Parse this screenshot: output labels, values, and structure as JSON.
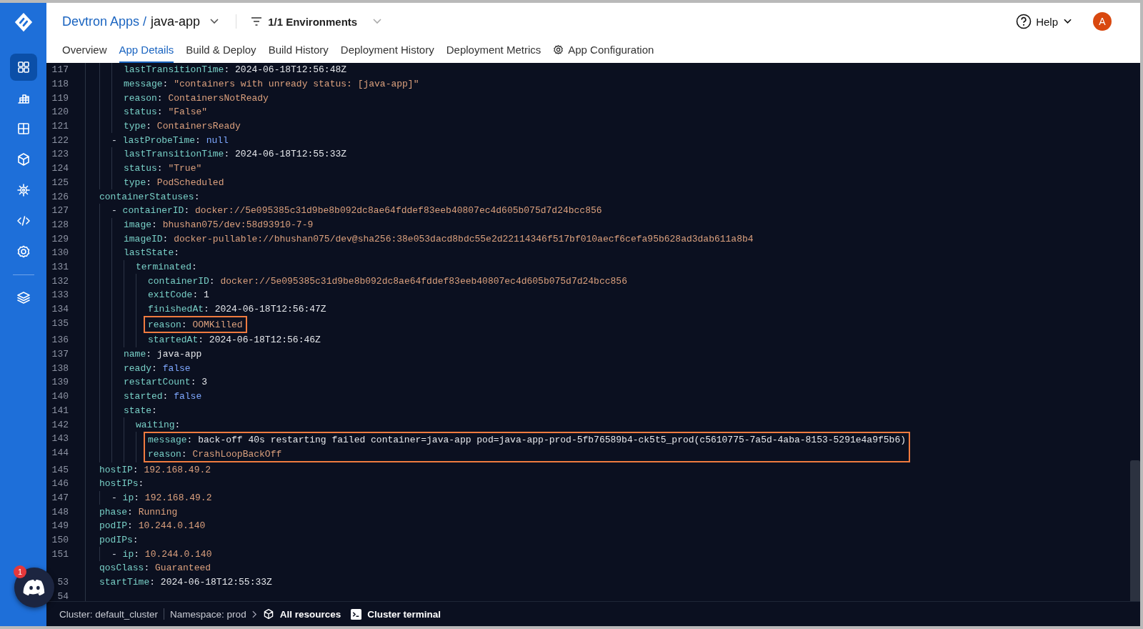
{
  "sidebar": {
    "items": [
      {
        "selected": true
      },
      {
        "selected": false
      },
      {
        "selected": false
      },
      {
        "selected": false
      },
      {
        "selected": false
      },
      {
        "selected": false
      },
      {
        "selected": false
      },
      {
        "selected": false
      }
    ]
  },
  "header": {
    "breadcrumb_parent": "Devtron Apps /",
    "app_name": "java-app",
    "environments": "1/1 Environments",
    "help": "Help",
    "avatar": "A"
  },
  "tabs": [
    {
      "label": "Overview",
      "selected": false
    },
    {
      "label": "App Details",
      "selected": true
    },
    {
      "label": "Build & Deploy",
      "selected": false
    },
    {
      "label": "Build History",
      "selected": false
    },
    {
      "label": "Deployment History",
      "selected": false
    },
    {
      "label": "Deployment Metrics",
      "selected": false
    },
    {
      "label": "App Configuration",
      "selected": false
    }
  ],
  "code": {
    "lines": [
      {
        "children": [
          {
            "children": [
              {
                "number": "117",
                "key": "lastTransitionTime:",
                "value": "2024-06-18T12:56:48Z",
                "kind": "plain"
              },
              {
                "number": "118",
                "key": "message:",
                "value": "\"containers with unready status: [java-app]\"",
                "kind": "string"
              },
              {
                "number": "119",
                "key": "reason:",
                "value": "ContainersNotReady",
                "kind": "string"
              },
              {
                "number": "120",
                "key": "status:",
                "value": "\"False\"",
                "kind": "string"
              },
              {
                "number": "121",
                "key": "type:",
                "value": "ContainersReady",
                "kind": "string"
              }
            ]
          },
          {
            "children": [
              {
                "number": "122",
                "marker": "-",
                "key": "lastProbeTime:",
                "value": "null",
                "kind": "keyword"
              },
              {
                "number": "123",
                "key": "lastTransitionTime:",
                "value": "2024-06-18T12:55:33Z",
                "kind": "plain"
              },
              {
                "number": "124",
                "key": "status:",
                "value": "\"True\"",
                "kind": "string"
              },
              {
                "number": "125",
                "key": "type:",
                "value": "PodScheduled",
                "kind": "string"
              }
            ]
          }
        ]
      },
      {
        "number": "126",
        "key": "containerStatuses:",
        "children": [
          {
            "children": [
              {
                "number": "127",
                "marker": "-",
                "key": "containerID:",
                "value": "docker://5e095385c31d9be8b092dc8ae64fddef83eeb40807ec4d605b075d7d24bcc856",
                "kind": "string"
              },
              {
                "number": "128",
                "key": "image:",
                "value": "bhushan075/dev:58d93910-7-9",
                "kind": "string"
              },
              {
                "number": "129",
                "key": "imageID:",
                "value": "docker-pullable://bhushan075/dev@sha256:38e053dacd8bdc55e2d22114346f517bf010aecf6cefa95b628ad3dab611a8b4",
                "kind": "string"
              },
              {
                "number": "130",
                "key": "lastState:",
                "children": [
                  {
                    "number": "131",
                    "key": "terminated:",
                    "children": [
                      {
                        "number": "132",
                        "key": "containerID:",
                        "value": "docker://5e095385c31d9be8b092dc8ae64fddef83eeb40807ec4d605b075d7d24bcc856",
                        "kind": "string"
                      },
                      {
                        "number": "133",
                        "key": "exitCode:",
                        "value": "1",
                        "kind": "plain"
                      },
                      {
                        "number": "134",
                        "key": "finishedAt:",
                        "value": "2024-06-18T12:56:47Z",
                        "kind": "plain"
                      },
                      {
                        "number": "135",
                        "key": "reason:",
                        "value": "OOMKilled",
                        "kind": "string",
                        "highlighted": true
                      },
                      {
                        "number": "136",
                        "key": "startedAt:",
                        "value": "2024-06-18T12:56:46Z",
                        "kind": "plain"
                      }
                    ]
                  }
                ]
              },
              {
                "number": "137",
                "key": "name:",
                "value": "java-app",
                "kind": "plain"
              },
              {
                "number": "138",
                "key": "ready:",
                "value": "false",
                "kind": "keyword"
              },
              {
                "number": "139",
                "key": "restartCount:",
                "value": "3",
                "kind": "plain"
              },
              {
                "number": "140",
                "key": "started:",
                "value": "false",
                "kind": "keyword"
              },
              {
                "number": "141",
                "key": "state:",
                "children": [
                  {
                    "number": "142",
                    "key": "waiting:",
                    "children": [
                      {
                        "number": "143",
                        "key": "message:",
                        "value": "back-off 40s restarting failed container=java-app pod=java-app-prod-5fb76589b4-ck5t5_prod(c5610775-7a5d-4aba-8153-5291e4a9f5b6)",
                        "kind": "plain",
                        "highlighted": true
                      },
                      {
                        "number": "144",
                        "key": "reason:",
                        "value": "CrashLoopBackOff",
                        "kind": "string",
                        "highlighted": true
                      }
                    ]
                  }
                ]
              }
            ]
          }
        ]
      },
      {
        "number": "145",
        "key": "hostIP:",
        "value": "192.168.49.2",
        "kind": "string"
      },
      {
        "number": "146",
        "key": "hostIPs:",
        "children": [
          {
            "children": [
              {
                "number": "147",
                "marker": "-",
                "key": "ip:",
                "value": "192.168.49.2",
                "kind": "string"
              }
            ]
          }
        ]
      },
      {
        "number": "148",
        "key": "phase:",
        "value": "Running",
        "kind": "string"
      },
      {
        "number": "149",
        "key": "podIP:",
        "value": "10.244.0.140",
        "kind": "string"
      },
      {
        "number": "150",
        "key": "podIPs:",
        "children": [
          {
            "children": [
              {
                "number": "151",
                "marker": "-",
                "key": "ip:",
                "value": "10.244.0.140",
                "kind": "string"
              }
            ]
          }
        ]
      },
      {
        "key": "qosClass:",
        "value": "Guaranteed",
        "kind": "string"
      },
      {
        "number": "53",
        "key": "startTime:",
        "value": "2024-06-18T12:55:33Z",
        "kind": "plain"
      },
      {
        "number": "54"
      }
    ]
  },
  "status_bar": {
    "cluster": "Cluster: default_cluster",
    "namespace": "Namespace: prod",
    "all_resources": "All resources",
    "cluster_terminal": "Cluster terminal"
  },
  "chat_button": {
    "badge": "1"
  }
}
